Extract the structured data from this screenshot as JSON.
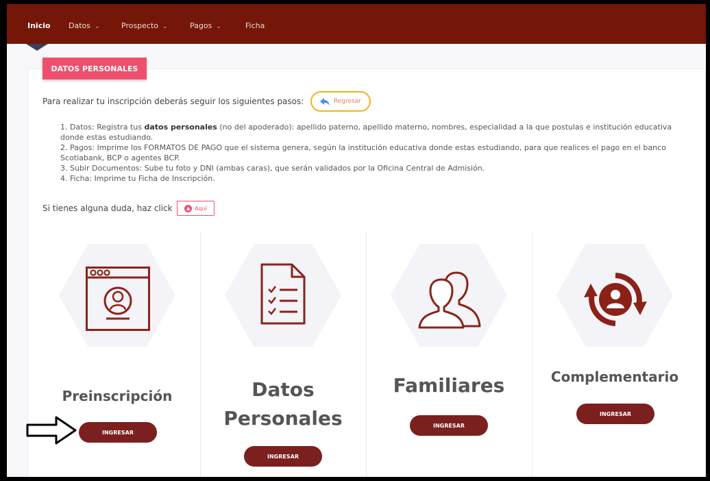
{
  "nav": {
    "inicio": "Inicio",
    "datos": "Datos",
    "prospecto": "Prospecto",
    "pagos": "Pagos",
    "ficha": "Ficha"
  },
  "section_tab": "DATOS PERSONALES",
  "intro_text": "Para realizar tu inscripción deberás seguir los siguientes pasos:",
  "regresar_label": "Regresar",
  "steps": [
    {
      "n": "1.",
      "pre": "Datos: Registra tus ",
      "bold": "datos personales",
      "post": " (no del apoderado): apellido paterno, apellido materno, nombres, especialidad a la que postulas e institución educativa donde estas estudiando."
    },
    {
      "n": "2.",
      "text": "Pagos: Imprime los FORMATOS DE PAGO que el sistema genera, según la institución educativa donde estas estudiando, para que realices el pago en el banco Scotiabank, BCP o agentes BCP."
    },
    {
      "n": "3.",
      "text": "Subir Documentos: Sube tu foto y DNI (ambas caras), que serán validados por la Oficina Central de Admisión."
    },
    {
      "n": "4.",
      "text": "Ficha: Imprime tu Ficha de Inscripción."
    }
  ],
  "duda_text": "Si tienes alguna duda, haz click",
  "aqui_label": "Aquí",
  "cards": [
    {
      "title": "Preinscripción",
      "button": "INGRESAR",
      "icon": "web-profile-icon"
    },
    {
      "title_line1": "Datos",
      "title_line2": "Personales",
      "button": "INGRESAR",
      "icon": "checklist-document-icon"
    },
    {
      "title": "Familiares",
      "button": "INGRESAR",
      "icon": "users-icon"
    },
    {
      "title": "Complementario",
      "button": "INGRESAR",
      "icon": "user-refresh-icon"
    }
  ],
  "colors": {
    "navbar": "#741709",
    "tab_badge": "#ef4f6d",
    "button": "#7b1f1f",
    "icon": "#8b2218",
    "regresar_border": "#f2b21c"
  }
}
